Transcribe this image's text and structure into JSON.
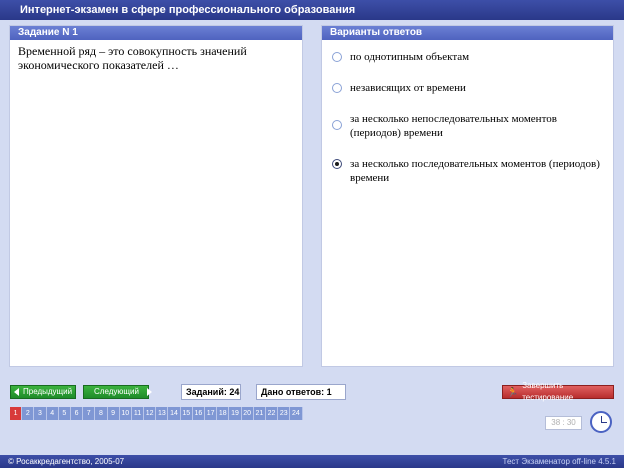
{
  "window": {
    "title": "Интернет-экзамен в сфере профессионального образования"
  },
  "task": {
    "header": "Задание N 1",
    "question": "Временной ряд – это совокупность значений экономического показателей …"
  },
  "answers": {
    "header": "Варианты ответов",
    "options": [
      {
        "text": "по однотипным объектам",
        "selected": false
      },
      {
        "text": "независящих от времени",
        "selected": false
      },
      {
        "text": "за несколько непоследовательных моментов (периодов) времени",
        "selected": false
      },
      {
        "text": "за несколько последовательных моментов (периодов) времени",
        "selected": true
      }
    ]
  },
  "toolbar": {
    "prev_label": "Предыдущий",
    "next_label": "Следующий",
    "tasks_count": "Заданий: 24",
    "answered_count": "Дано ответов: 1",
    "finish_label": "Завершить тестирование"
  },
  "question_numbers": [
    "1",
    "2",
    "3",
    "4",
    "5",
    "6",
    "7",
    "8",
    "9",
    "10",
    "11",
    "12",
    "13",
    "14",
    "15",
    "16",
    "17",
    "18",
    "19",
    "20",
    "21",
    "22",
    "23",
    "24"
  ],
  "current_question": "1",
  "timer": {
    "display": "38 : 30"
  },
  "footer": {
    "copyright": "© Росаккредагентство, 2005-07",
    "version": "Тест Экзаменатор off-line 4.5.1"
  },
  "colors": {
    "title_bar": "#2a3889",
    "panel_header": "#5a6fc8",
    "nav_button": "#2a9e33",
    "finish_button": "#c93a3a",
    "active_question": "#d83a3a",
    "question_cell": "#7f97d4"
  },
  "icons": {
    "prev": "triangle-left-icon",
    "next": "triangle-right-icon",
    "finish": "running-man-icon",
    "clock": "clock-icon"
  }
}
